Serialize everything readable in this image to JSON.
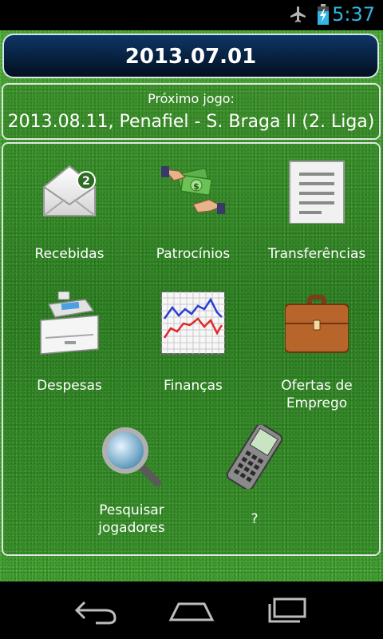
{
  "status": {
    "time": "5:37"
  },
  "header": {
    "date": "2013.07.01"
  },
  "next_game": {
    "label": "Próximo jogo:",
    "match": "2013.08.11, Penafiel - S. Braga II (2. Liga)"
  },
  "menu": {
    "recebidas": {
      "label": "Recebidas",
      "badge": "2",
      "icon": "mail-envelope-icon"
    },
    "patrocinios": {
      "label": "Patrocínios",
      "icon": "money-hands-icon"
    },
    "transferencias": {
      "label": "Transferências",
      "icon": "document-icon"
    },
    "despesas": {
      "label": "Despesas",
      "icon": "cash-register-icon"
    },
    "financas": {
      "label": "Finanças",
      "icon": "line-chart-icon"
    },
    "ofertas": {
      "label": "Ofertas de Emprego",
      "icon": "briefcase-icon"
    },
    "pesquisar": {
      "label_line1": "Pesquisar",
      "label_line2": "jogadores",
      "icon": "magnifier-icon"
    },
    "unknown": {
      "label": "?",
      "icon": "mobile-phone-icon"
    }
  },
  "colors": {
    "header_bg": "#07213f",
    "status_accent": "#33b5e5",
    "field_green": "#3c9b2b"
  }
}
